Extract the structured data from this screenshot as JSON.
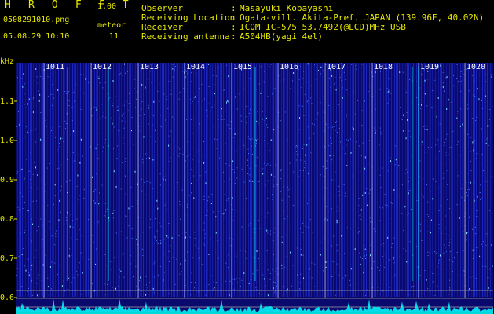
{
  "header": {
    "app_title": "H R O F F T",
    "version": "1.00",
    "filename": "0508291010.png",
    "mode_label": "meteor",
    "datetime": "05.08.29 10:10",
    "meteor_count": "11"
  },
  "station_info": [
    {
      "label": "Observer",
      "value": "Masayuki Kobayashi"
    },
    {
      "label": "Receiving Location",
      "value": "Ogata-vill. Akita-Pref. JAPAN (139.96E, 40.02N)"
    },
    {
      "label": "Receiver",
      "value": "ICOM IC-575 53.7492(@LCD)MHz USB"
    },
    {
      "label": "Receiving antenna",
      "value": "A504HB(yagi 4el)"
    }
  ],
  "spectrogram": {
    "y_unit": "kHz",
    "y_ticks": [
      "1.1",
      "1.0",
      "0.9",
      "0.8",
      "0.7",
      "0.6"
    ],
    "time_ticks": [
      "1011",
      "1012",
      "1013",
      "1014",
      "1015",
      "1016",
      "1017",
      "1018",
      "1019",
      "1020"
    ],
    "colors": {
      "label_yellow": "#e6e600",
      "background_blue": "#0a0a6e",
      "signal_cyan": "#00ffff",
      "minute_marker": "#ffffff"
    }
  }
}
